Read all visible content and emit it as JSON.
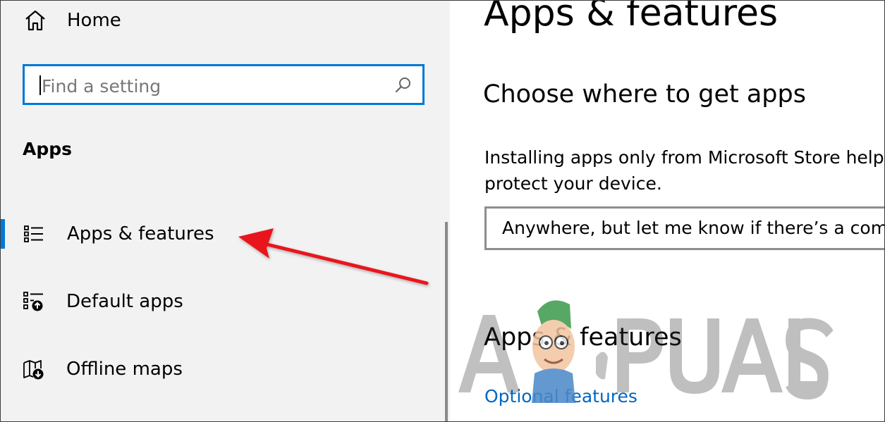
{
  "sidebar": {
    "home_label": "Home",
    "search_placeholder": "Find a setting",
    "section_title": "Apps",
    "items": [
      {
        "label": "Apps & features",
        "icon": "list-icon",
        "active": true
      },
      {
        "label": "Default apps",
        "icon": "default-apps-icon",
        "active": false
      },
      {
        "label": "Offline maps",
        "icon": "offline-maps-icon",
        "active": false
      }
    ]
  },
  "main": {
    "page_title": "Apps & features",
    "choose_heading": "Choose where to get apps",
    "choose_desc": "Installing apps only from Microsoft Store helps protect your device.",
    "source_dropdown_value": "Anywhere, but let me know if there’s a comparable app in the Microsoft Store",
    "features_heading": "Apps & features",
    "optional_features_link": "Optional features"
  },
  "watermark": {
    "text": "APPUALS"
  },
  "colors": {
    "accent": "#0078d7",
    "link": "#0067c0",
    "sidebar_bg": "#f2f2f2",
    "annotation_arrow": "#e8191c"
  }
}
